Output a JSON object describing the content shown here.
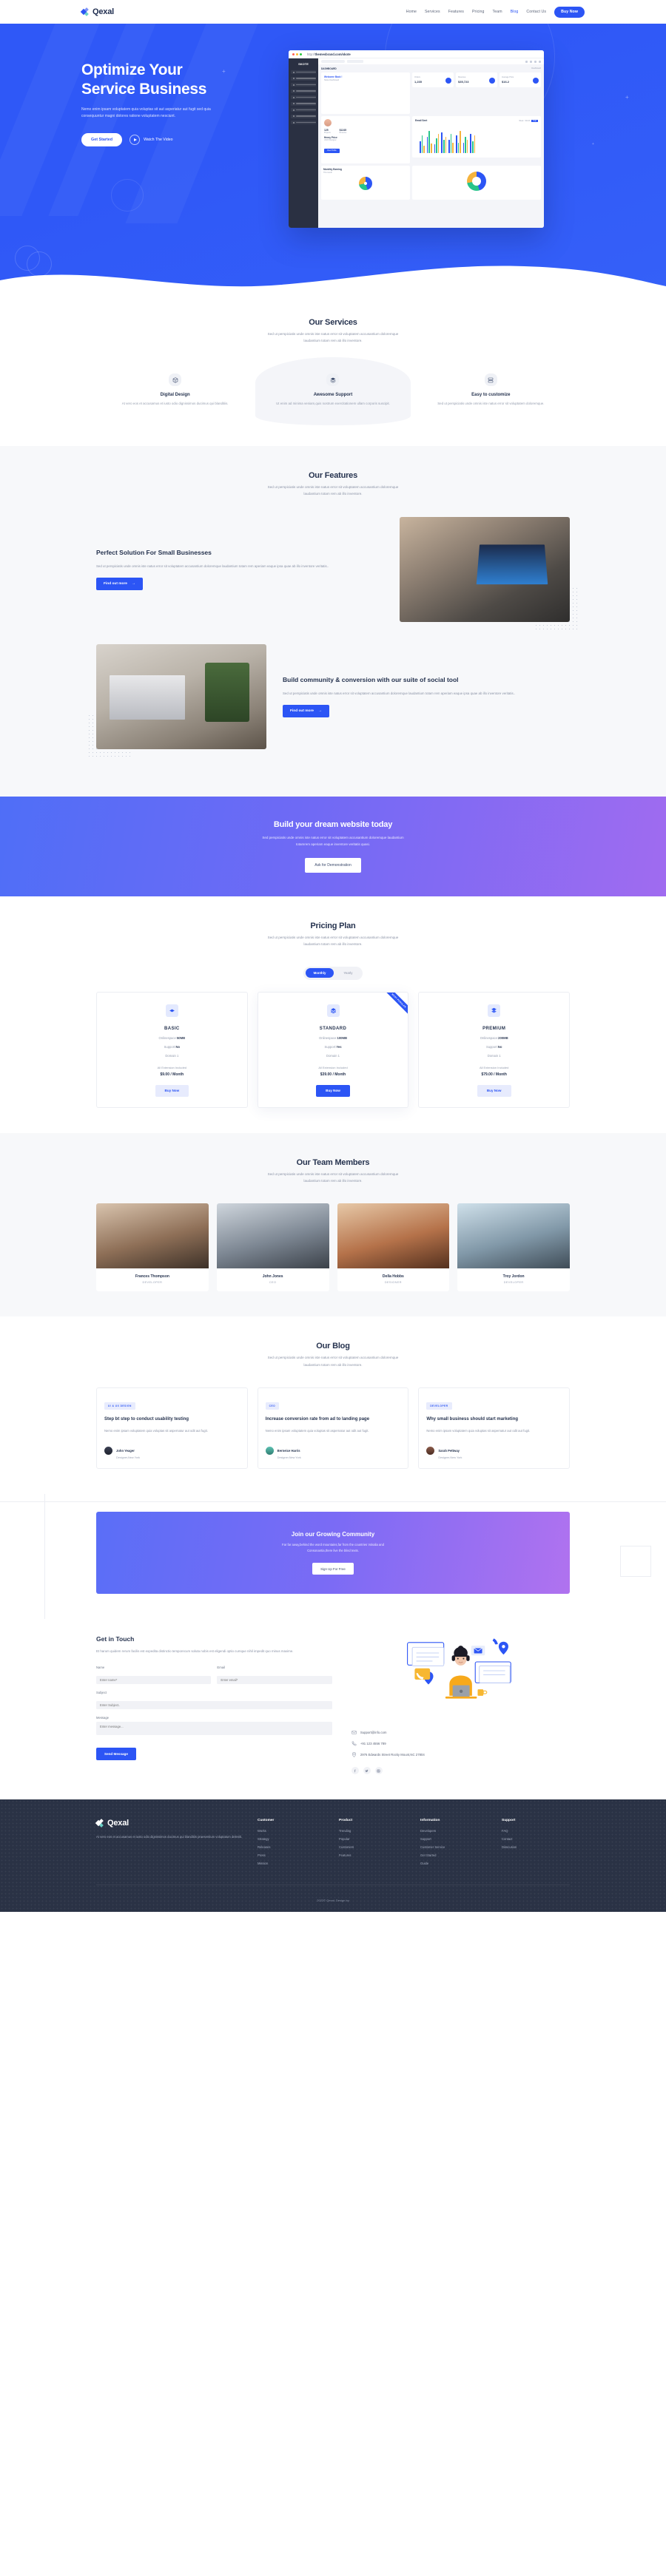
{
  "brand": {
    "name": "Qexal"
  },
  "nav": {
    "links": [
      {
        "label": "Home",
        "active": false
      },
      {
        "label": "Services",
        "active": false
      },
      {
        "label": "Features",
        "active": false
      },
      {
        "label": "Pricing",
        "active": false
      },
      {
        "label": "Team",
        "active": false
      },
      {
        "label": "Blog",
        "active": true
      },
      {
        "label": "Contact Us",
        "active": false
      }
    ],
    "buy_label": "Buy Now"
  },
  "hero": {
    "title_line1": "Optimize Your",
    "title_line2": "Service Business",
    "paragraph": "Nemo enim ipsam voluptatem quia voluptas sit aut asperiatur aut fugit sed quia consequuntur magni dolores ratione voluptatem nesciunt.",
    "primary_btn": "Get Started",
    "secondary_btn": "Watch The Video",
    "dashboard": {
      "url_prefix": "http://",
      "url_main": "themesbrand.com/skote",
      "logo": "SKOTE",
      "section_label": "DASHBOARD",
      "breadcrumb": "Dashboard",
      "welcome_title": "Welcome Back !",
      "welcome_sub": "Skote Dashboard",
      "profile_name": "Henry Price",
      "profile_role": "UI/UX Designer",
      "profile_btn": "View Profile",
      "stat_projects_value": "125",
      "stat_projects_label": "Projects",
      "stat_revenue_value": "$1245",
      "stat_revenue_label": "Revenue",
      "kpis": [
        {
          "label": "Orders",
          "value": "1,235"
        },
        {
          "label": "Revenue",
          "value": "$35,723"
        },
        {
          "label": "Average Price",
          "value": "$16.2"
        }
      ],
      "chart_title": "Email Sent",
      "chart_tabs": [
        "Week",
        "Month",
        "Year"
      ],
      "monthly_title": "Monthly Earning",
      "monthly_sub": "This month"
    }
  },
  "services": {
    "title": "Our Services",
    "sub_line1": "Sed ut perspiciatis unde omnis iste natus error sit voluptatem accusantium doloremque",
    "sub_line2": "laudantium totam rem ab illo inventore.",
    "items": [
      {
        "icon": "cube-icon",
        "title": "Digital Design",
        "text": "At vero eos et accusamus et iusto odio dignissimos ducimus qui blanditiis."
      },
      {
        "icon": "layers-icon",
        "title": "Awesome Support",
        "text": "Ut enim ad minima veniam,quis nostrum exercitationem ullam corporis suscipit."
      },
      {
        "icon": "server-icon",
        "title": "Easy to customize",
        "text": "Sed ut perspiciatis unde omnis iste natus error sit voluptatem doloremque."
      }
    ]
  },
  "features": {
    "title": "Our Features",
    "sub_line1": "Sed ut perspiciatis unde omnis iste natus error sit voluptatem accusantium doloremque",
    "sub_line2": "laudantium totam rem ab illo inventore.",
    "rows": [
      {
        "heading": "Perfect Solution For Small Businesses",
        "text": "Sed ut perspiciatis unde omnis iste natus error sit voluptatem accusantium doloremque laudantium totam rem aperiam eaque ipsa quae ab illo inventore veritatis..",
        "btn": "Find out more"
      },
      {
        "heading": "Build community & conversion with our suite of social tool",
        "text": "Sed ut perspiciatis unde omnis iste natus error sit voluptatem accusantium doloremque laudantium totam rem aperiam eaque ipsa quae ab illo inventore veritatis..",
        "btn": "Find out more"
      }
    ]
  },
  "cta": {
    "heading": "Build your dream website today",
    "sub_line1": "Sed perspiciatis unde omnis iste natus error sit voluptatem accusantium doloremque laudantium",
    "sub_line2": "totamrem aperiam eaque inventore veritatis quasi.",
    "button": "Ask for Demonstration"
  },
  "pricing": {
    "title": "Pricing Plan",
    "sub_line1": "Sed ut perspiciatis unde omnis iste natus error sit voluptatem accusantium doloremque",
    "sub_line2": "laudantium totam rem ab illo inventore.",
    "toggle": {
      "monthly": "Monthly",
      "yearly": "Yearly",
      "selected": "Monthly"
    },
    "ribbon": "MOST POPULAR",
    "plans": [
      {
        "icon": "diamond-icon",
        "name": "BASIC",
        "space_label": "Onlinespace:",
        "space_value": "50MB",
        "support_label": "Support:",
        "support_value": "No",
        "domain": "Domain 1",
        "extension": "All Extension Included",
        "price": "$9.00 / Month",
        "button": "Buy Now",
        "featured": false
      },
      {
        "icon": "layers-icon",
        "name": "STANDARD",
        "space_label": "Onlinespace:",
        "space_value": "100MB",
        "support_label": "Support:",
        "support_value": "Yes",
        "domain": "Domain 1",
        "extension": "All Extension Included",
        "price": "$39.00 / Month",
        "button": "Buy Now",
        "featured": true
      },
      {
        "icon": "stack-icon",
        "name": "PREMIUM",
        "space_label": "Onlinespace:",
        "space_value": "200MB",
        "support_label": "Support:",
        "support_value": "No",
        "domain": "Domain 1",
        "extension": "All Extension Included",
        "price": "$79.00 / Month",
        "button": "Buy Now",
        "featured": false
      }
    ]
  },
  "team": {
    "title": "Our Team Members",
    "sub_line1": "Sed ut perspiciatis unde omnis iste natus error sit voluptatem accusantium doloremque",
    "sub_line2": "laudantium totam rem ab illo inventore.",
    "members": [
      {
        "name": "Frances Thompson",
        "role": "DEVELOPER"
      },
      {
        "name": "John Jones",
        "role": "CEO"
      },
      {
        "name": "Della Hobbs",
        "role": "DESIGNER"
      },
      {
        "name": "Troy Jordon",
        "role": "DEVELOPER"
      }
    ]
  },
  "blog": {
    "title": "Our Blog",
    "sub_line1": "Sed ut perspiciatis unde omnis iste natus error sit voluptatem accusantium doloremque",
    "sub_line2": "laudantium totam rem ab illo inventore.",
    "posts": [
      {
        "tag": "UI & UX DESIGN",
        "title": "Step bt step to conduct usability testing",
        "excerpt": "Nemo enim ipsam voluptatem quia voluptas sit aspernatur aut odit aut fugit.",
        "author": "John Yeager",
        "author_role": "Designer,New York"
      },
      {
        "tag": "CEO",
        "title": "Increase conversion rate from ad to landing page",
        "excerpt": "Nemo enim ipsam voluptatem quia voluptas sit aspernatur aut odit aut fugit.",
        "author": "Berneice Harris",
        "author_role": "Designer,New York"
      },
      {
        "tag": "DEVELOPER",
        "title": "Why small business should start marketing",
        "excerpt": "Nemo enim ipsam voluptatem quia voluptas sit aspernatur aut odit aut fugit.",
        "author": "Sarah Pettway",
        "author_role": "Designer,New York"
      }
    ]
  },
  "community": {
    "heading": "Join our Growing Community",
    "sub_line1": "Far far away,behind the word mountains,far from the countries Vokalia and",
    "sub_line2": "Consonantia,there live the blind texts.",
    "button": "Sign Up For Free"
  },
  "contact": {
    "heading": "Get in Touch",
    "paragraph": "Et harum quidem rerum facilis est expedita distinctio temporecum soluta nobis est eligendi optio cumque nihil impedit quo minus maxime.",
    "fields": {
      "name_label": "Name",
      "name_placeholder": "Enter name*",
      "email_label": "Email",
      "email_placeholder": "Enter email*",
      "subject_label": "Subject",
      "subject_placeholder": "Enter Subject..",
      "message_label": "Message",
      "message_placeholder": "Enter message..."
    },
    "send_button": "Send Message",
    "info": [
      {
        "icon": "mail-icon",
        "text": "Support@info.com"
      },
      {
        "icon": "phone-icon",
        "text": "+91 123 4556 789"
      },
      {
        "icon": "location-icon",
        "text": "2976 Edwards Street Rocky Mount,NC 27804"
      }
    ],
    "socials": [
      "facebook-icon",
      "twitter-icon",
      "instagram-icon"
    ]
  },
  "footer": {
    "brand": "Qexal",
    "description": "At vero eos et accusamus et iusto odio dignissimos ducimus qui blanditiis praesentium voluptatum deleniti.",
    "columns": [
      {
        "title": "Customer",
        "links": [
          "Works",
          "Strategy",
          "Releases",
          "Press",
          "Mission"
        ]
      },
      {
        "title": "Product",
        "links": [
          "Trending",
          "Popular",
          "Customers",
          "Features"
        ]
      },
      {
        "title": "Information",
        "links": [
          "Developers",
          "Support",
          "Customer Service",
          "Get Started",
          "Guide"
        ]
      },
      {
        "title": "Support",
        "links": [
          "FAQ",
          "Contact",
          "Disscusion"
        ]
      }
    ],
    "copyright": "2022© Qexal. Design by"
  },
  "colors": {
    "primary": "#2c55f5",
    "hero_bg": "#2f58f7",
    "dark": "#2a3245",
    "muted": "#8b93a6",
    "purple": "#a06bf0"
  }
}
